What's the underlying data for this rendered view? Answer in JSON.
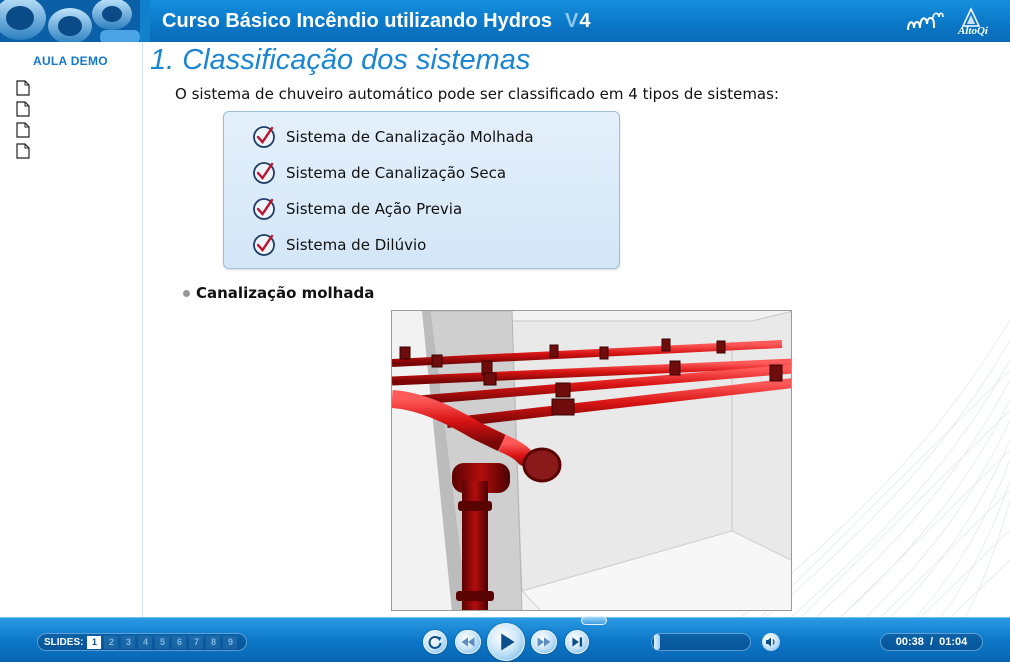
{
  "header": {
    "course_title": "Curso Básico Incêndio utilizando Hydros",
    "version_prefix": "V",
    "version_number": "4",
    "brand_text": "AltoQi",
    "accent_color": "#0a78c8"
  },
  "sidebar": {
    "title": "AULA DEMO",
    "pages": [
      {
        "icon": "page-icon"
      },
      {
        "icon": "page-icon"
      },
      {
        "icon": "page-icon"
      },
      {
        "icon": "page-icon"
      }
    ]
  },
  "slide": {
    "title": "1. Classificação dos sistemas",
    "intro": "O sistema de chuveiro automático pode ser classificado em 4 tipos de sistemas:",
    "types": [
      {
        "label": "Sistema de Canalização Molhada",
        "icon": "check-icon"
      },
      {
        "label": "Sistema de Canalização Seca",
        "icon": "check-icon"
      },
      {
        "label": "Sistema de Ação Previa",
        "icon": "check-icon"
      },
      {
        "label": "Sistema de Dilúvio",
        "icon": "check-icon"
      }
    ],
    "bullet": "Canalização molhada",
    "illustration_icon": "sprinkler-piping-illustration"
  },
  "player": {
    "slides_label": "SLIDES:",
    "slide_numbers": [
      "1",
      "2",
      "3",
      "4",
      "5",
      "6",
      "7",
      "8",
      "9"
    ],
    "current_slide": "1",
    "elapsed": "00:38",
    "separator": "/",
    "total": "01:04",
    "controls": [
      "replay-icon",
      "rewind-icon",
      "play-icon",
      "fast-forward-icon",
      "next-slide-icon",
      "speaker-icon"
    ],
    "volume_level": 0.02
  }
}
